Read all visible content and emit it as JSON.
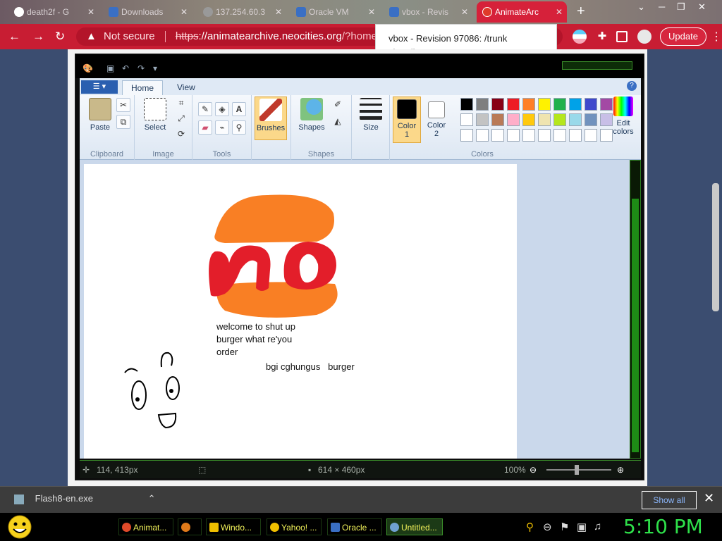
{
  "browser": {
    "tabs": [
      {
        "label": "death2f - G",
        "icon": "google-icon",
        "color": "#ffffff"
      },
      {
        "label": "Downloads",
        "icon": "downloads-page-icon",
        "color": "#3a6fc4"
      },
      {
        "label": "137.254.60.3",
        "icon": "globe-icon",
        "color": "#888888"
      },
      {
        "label": "Oracle VM",
        "icon": "virtualbox-icon",
        "color": "#3a6fc4"
      },
      {
        "label": "vbox - Revis",
        "icon": "virtualbox-icon",
        "color": "#3a6fc4"
      },
      {
        "label": "AnimateArc",
        "icon": "flash-icon",
        "color": "#e03a2a"
      }
    ],
    "new_tab": "+",
    "address": {
      "warning": "Not secure",
      "scheme": "https",
      "rest": "://animatearchive.neocities.org",
      "path": "/?home"
    },
    "update_label": "Update",
    "tooltip_line1": "vbox - Revision 97086: /trunk",
    "tooltip_line2": "virtualbox.org"
  },
  "paint": {
    "ribbon_tabs": {
      "home": "Home",
      "view": "View"
    },
    "groups": {
      "clipboard": "Clipboard",
      "image": "Image",
      "tools": "Tools",
      "shapes": "Shapes",
      "colors": "Colors"
    },
    "buttons": {
      "paste": "Paste",
      "select": "Select",
      "brushes": "Brushes",
      "shapes": "Shapes",
      "size": "Size",
      "color1": "Color",
      "color1_num": "1",
      "color2": "Color",
      "color2_num": "2",
      "edit_colors": "Edit",
      "edit_colors2": "colors"
    },
    "palette": [
      [
        "#000000",
        "#7f7f7f",
        "#880015",
        "#ed1c24",
        "#ff7f27",
        "#fff200",
        "#22b14c",
        "#00a2e8",
        "#3f48cc",
        "#a349a4"
      ],
      [
        "#ffffff",
        "#c3c3c3",
        "#b97a57",
        "#ffaec9",
        "#ffc90e",
        "#efe4b0",
        "#b5e61d",
        "#99d9ea",
        "#7092be",
        "#c8bfe7"
      ],
      [
        "#ffffff",
        "#ffffff",
        "#ffffff",
        "#ffffff",
        "#ffffff",
        "#ffffff",
        "#ffffff",
        "#ffffff",
        "#ffffff",
        "#ffffff"
      ]
    ],
    "canvas_text": {
      "line1": "welcome to shut up",
      "line2": "burger what re'you",
      "line3": "order",
      "caption": "bgi cghungus   burger"
    },
    "status": {
      "cursor": "114, 413px",
      "size": "614 × 460px",
      "zoom": "100%"
    }
  },
  "downloads": {
    "file": "Flash8-en.exe",
    "show_all": "Show all"
  },
  "taskbar": {
    "items": [
      {
        "label": "Animat...",
        "color": "#e04a2a"
      },
      {
        "label": "",
        "color": "#e07a1a"
      },
      {
        "label": "Windo...",
        "color": "#f0c000"
      },
      {
        "label": "Yahoo! ...",
        "color": "#f0c000"
      },
      {
        "label": "Oracle ...",
        "color": "#3a6fc4"
      },
      {
        "label": "Untitled...",
        "color": "#6fa0d0"
      }
    ],
    "clock": "5:10 PM"
  }
}
